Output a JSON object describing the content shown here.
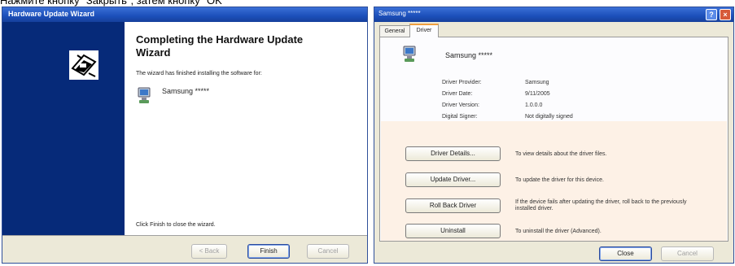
{
  "caption": "Нажмите кнопку \"Закрыть\", затем кнопку \"OK\"",
  "wizard": {
    "title": "Hardware Update Wizard",
    "heading": "Completing the Hardware Update Wizard",
    "body_text": "The wizard has finished installing the software for:",
    "device_name": "Samsung *****",
    "finish_text": "Click Finish to close the wizard.",
    "buttons": {
      "back": "< Back",
      "finish": "Finish",
      "cancel": "Cancel"
    }
  },
  "properties": {
    "title": "Samsung *****",
    "tabs": [
      "General",
      "Driver"
    ],
    "active_tab": "Driver",
    "device_name": "Samsung *****",
    "info": [
      {
        "label": "Driver Provider:",
        "value": "Samsung"
      },
      {
        "label": "Driver Date:",
        "value": "9/11/2005"
      },
      {
        "label": "Driver Version:",
        "value": "1.0.0.0"
      },
      {
        "label": "Digital Signer:",
        "value": "Not digitally signed"
      }
    ],
    "actions": [
      {
        "button": "Driver Details...",
        "description": "To view details about the driver files."
      },
      {
        "button": "Update Driver...",
        "description": "To update the driver for this device."
      },
      {
        "button": "Roll Back Driver",
        "description": "If the device fails after updating the driver, roll back to the previously installed driver."
      },
      {
        "button": "Uninstall",
        "description": "To uninstall the driver (Advanced)."
      }
    ],
    "footer_buttons": {
      "close": "Close",
      "cancel": "Cancel"
    }
  }
}
